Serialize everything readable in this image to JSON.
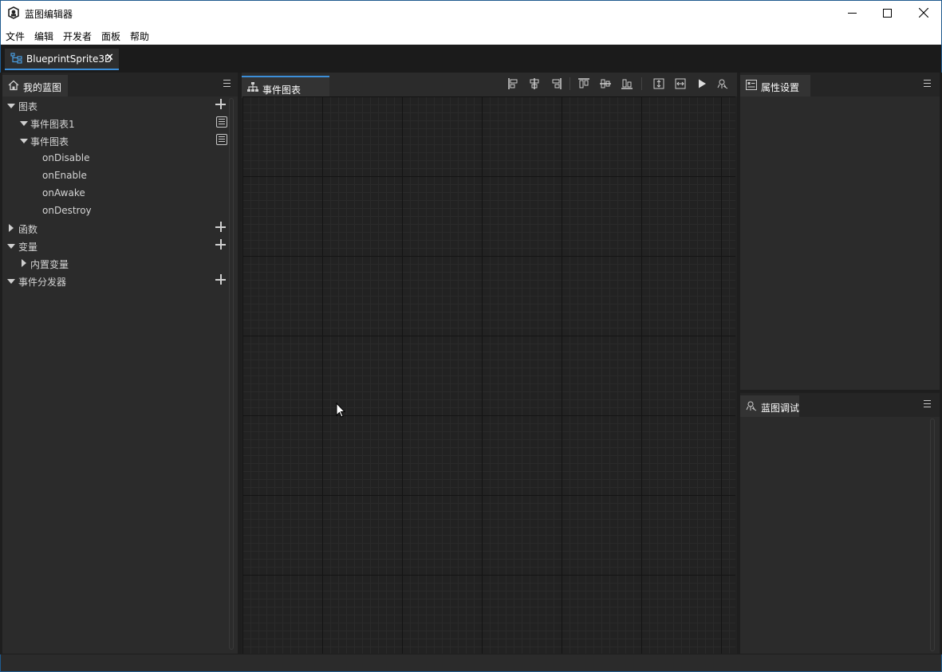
{
  "window": {
    "title": "蓝图编辑器"
  },
  "menu": [
    "文件",
    "编辑",
    "开发者",
    "面板",
    "帮助"
  ],
  "doc_tab": {
    "label": "BlueprintSprite3D",
    "close": "✕"
  },
  "left_panel": {
    "title": "我的蓝图",
    "tree": {
      "charts": "图表",
      "event_chart1": "事件图表1",
      "event_chart": "事件图表",
      "events": [
        "onDisable",
        "onEnable",
        "onAwake",
        "onDestroy"
      ],
      "functions": "函数",
      "variables": "变量",
      "builtin_vars": "内置变量",
      "dispatchers": "事件分发器"
    }
  },
  "center_panel": {
    "title": "事件图表"
  },
  "props_panel": {
    "title": "属性设置"
  },
  "debug_panel": {
    "title": "蓝图调试"
  },
  "colors": {
    "accent": "#3c8ed8",
    "panel": "#2b2b2b",
    "canvas": "#222222"
  }
}
